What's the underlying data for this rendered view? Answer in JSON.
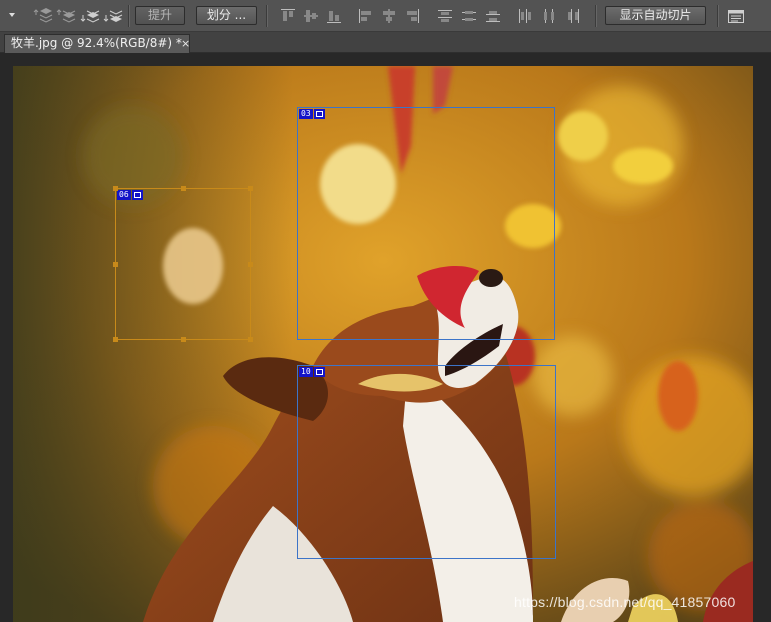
{
  "options_bar": {
    "promote_label": "提升",
    "divide_label": "划分 ...",
    "show_auto_slices_label": "显示自动切片"
  },
  "document": {
    "tab_title": "牧羊.jpg @ 92.4%(RGB/8#) *",
    "close_glyph": "×"
  },
  "slices": [
    {
      "number": "03",
      "kind": "user",
      "selected": false
    },
    {
      "number": "06",
      "kind": "user",
      "selected": true
    },
    {
      "number": "10",
      "kind": "user",
      "selected": false
    }
  ],
  "watermark": "https://blog.csdn.net/qq_41857060",
  "icons": [
    "dropdown-arrow-icon",
    "bring-to-front-icon",
    "bring-forward-icon",
    "send-backward-icon",
    "send-to-back-icon",
    "align-top-icon",
    "align-vcenter-icon",
    "align-bottom-icon",
    "align-left-icon",
    "align-hcenter-icon",
    "align-right-icon",
    "distribute-top-icon",
    "distribute-vcenter-icon",
    "distribute-bottom-icon",
    "distribute-left-icon",
    "distribute-hcenter-icon",
    "distribute-right-icon",
    "slice-options-icon"
  ]
}
